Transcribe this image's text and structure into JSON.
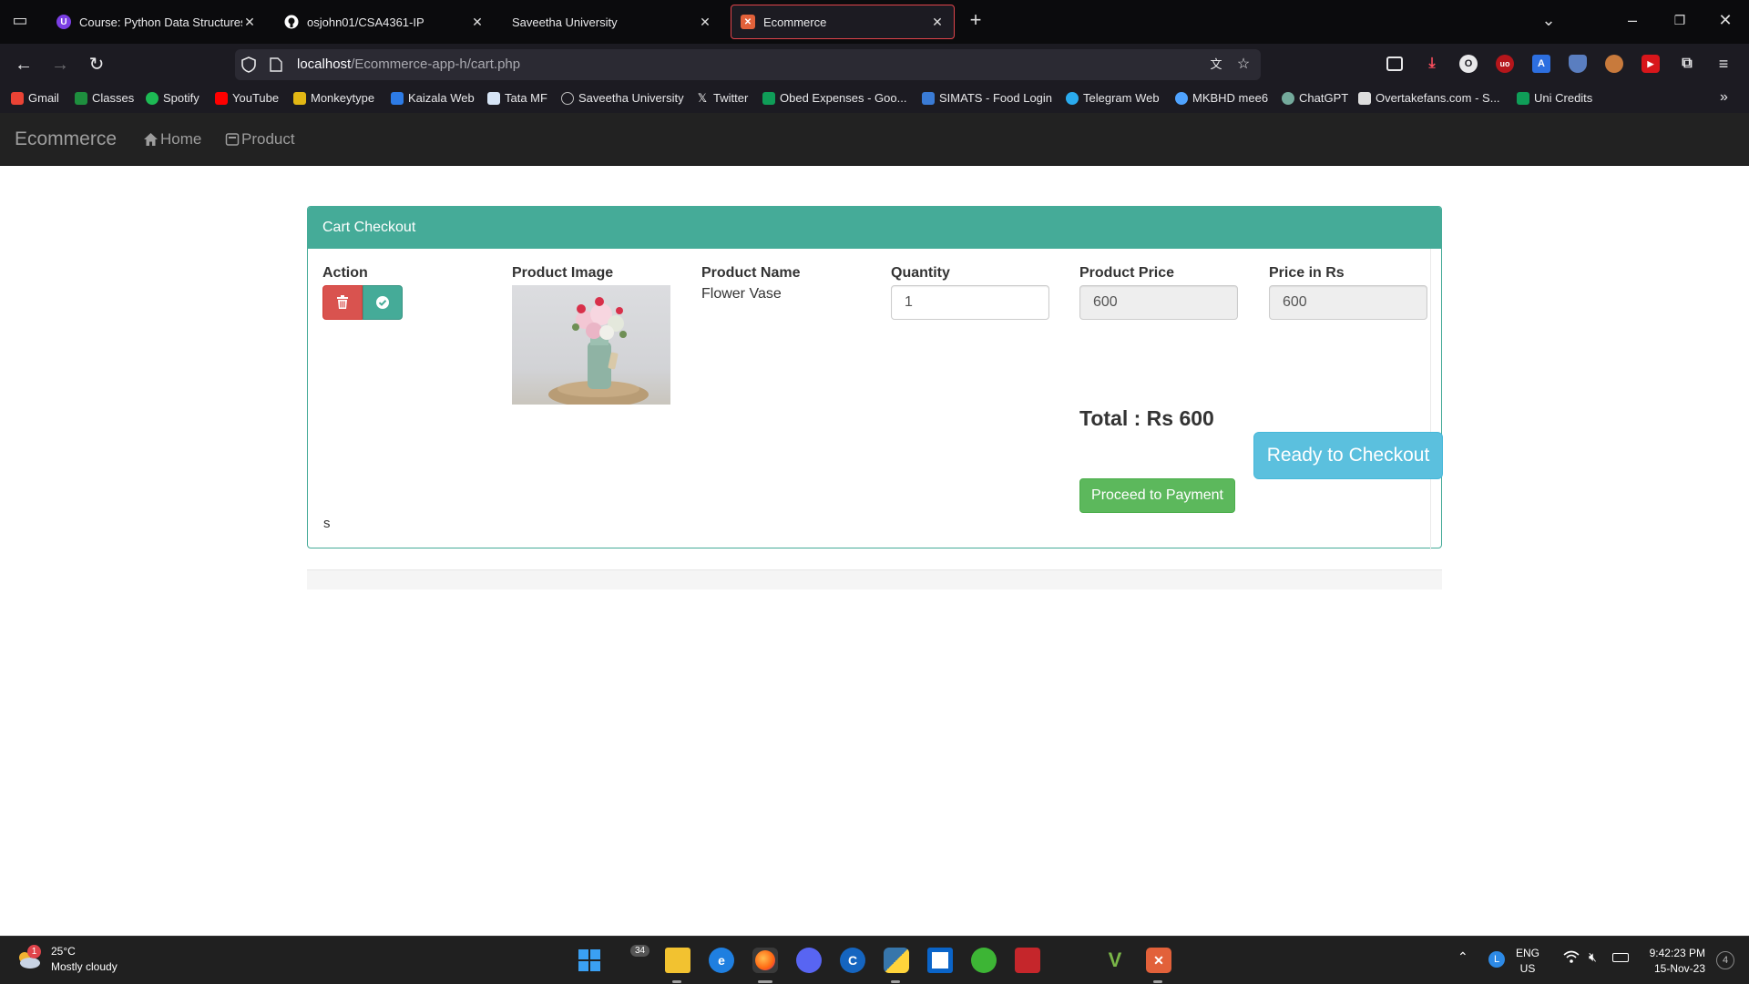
{
  "browser": {
    "tabs": [
      {
        "label": "Course: Python Data Structures",
        "color": "#7b3fe4",
        "glyph": "U"
      },
      {
        "label": "osjohn01/CSA4361-IP",
        "color": "#24292f",
        "glyph": ""
      },
      {
        "label": "Saveetha University",
        "color": "",
        "glyph": ""
      },
      {
        "label": "Ecommerce",
        "color": "#e2613a",
        "glyph": "✕"
      }
    ],
    "url_host": "localhost",
    "url_path": "/Ecommerce-app-h/cart.php",
    "bookmarks": [
      {
        "label": "Gmail",
        "color": "#ea4335"
      },
      {
        "label": "Classes",
        "color": "#1e8e3e"
      },
      {
        "label": "Spotify",
        "color": "#1db954"
      },
      {
        "label": "YouTube",
        "color": "#ff0000"
      },
      {
        "label": "Monkeytype",
        "color": "#e2b714"
      },
      {
        "label": "Kaizala Web",
        "color": "#2d7be5"
      },
      {
        "label": "Tata MF",
        "color": "#d6e4f5"
      },
      {
        "label": "Saveetha University",
        "color": "#bbbbbb"
      },
      {
        "label": "Twitter",
        "color": "#ffffff"
      },
      {
        "label": "Obed Expenses - Goo...",
        "color": "#0f9d58"
      },
      {
        "label": "SIMATS - Food Login",
        "color": "#3a7bd5"
      },
      {
        "label": "Telegram Web",
        "color": "#2aabee"
      },
      {
        "label": "MKBHD mee6",
        "color": "#4fa3ff"
      },
      {
        "label": "ChatGPT",
        "color": "#74aa9c"
      },
      {
        "label": "Overtakefans.com - S...",
        "color": "#dddddd"
      },
      {
        "label": "Uni Credits",
        "color": "#0f9d58"
      }
    ]
  },
  "app": {
    "brand": "Ecommerce",
    "nav": {
      "home": "Home",
      "product": "Product"
    }
  },
  "cart": {
    "heading": "Cart Checkout",
    "columns": {
      "action": "Action",
      "image": "Product Image",
      "name": "Product Name",
      "quantity": "Quantity",
      "price": "Product Price",
      "price_rs": "Price in Rs"
    },
    "item": {
      "name": "Flower Vase",
      "quantity": "1",
      "price": "600",
      "price_rs": "600"
    },
    "total": "Total : Rs 600",
    "ready_button": "Ready to Checkout",
    "pay_button": "Proceed to Payment",
    "stray_text": "s"
  },
  "taskbar": {
    "weather_temp": "25°C",
    "weather_desc": "Mostly cloudy",
    "weather_badge": "1",
    "widget_count": "34",
    "lang_top": "ENG",
    "lang_bottom": "US",
    "time": "9:42:23 PM",
    "date": "15-Nov-23",
    "notif_count": "4"
  }
}
